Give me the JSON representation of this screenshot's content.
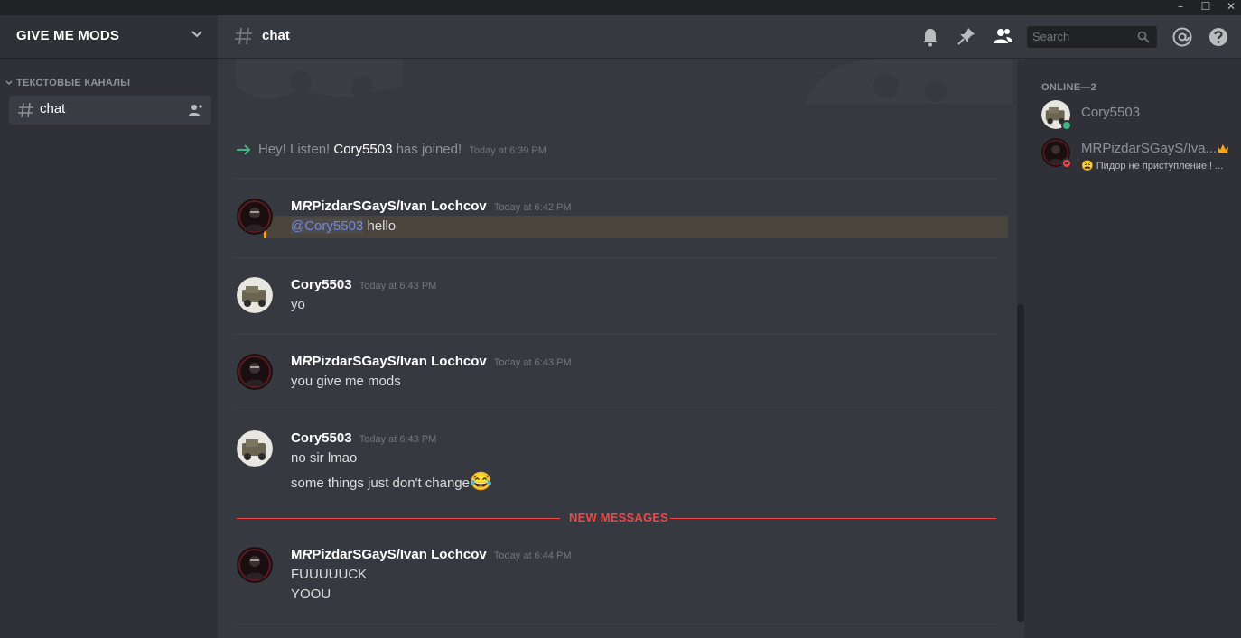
{
  "window": {
    "minimize_glyph": "–",
    "maximize_glyph": "☐",
    "close_glyph": "✕"
  },
  "server": {
    "name": "GIVE ME MODS",
    "category": "ТЕКСТОВЫЕ КАНАЛЫ",
    "channels": [
      {
        "label": "chat",
        "active": true
      }
    ]
  },
  "header": {
    "channel": "chat",
    "search_placeholder": "Search",
    "icons": [
      "bell-icon",
      "pin-icon",
      "members-icon",
      "mention-icon",
      "help-icon"
    ]
  },
  "messages": {
    "system": {
      "prefix": "Hey! Listen! ",
      "user": "Cory5503",
      "suffix": " has joined!",
      "time": "Today at 6:39 PM"
    },
    "groups": [
      {
        "author_pre": "M",
        "author_mid": "R",
        "author_post": "PizdarSGayS/Ivan Lochcov",
        "time": "Today at 6:42 PM",
        "mention": "@Cory5503",
        "lines": [
          "hello"
        ]
      },
      {
        "author": "Cory5503",
        "time": "Today at 6:43 PM",
        "lines": [
          "yo"
        ]
      },
      {
        "author_pre": "M",
        "author_mid": "R",
        "author_post": "PizdarSGayS/Ivan Lochcov",
        "time": "Today at 6:43 PM",
        "lines": [
          "you give me mods"
        ]
      },
      {
        "author": "Cory5503",
        "time": "Today at 6:43 PM",
        "lines": [
          "no sir lmao",
          "some things just don't change"
        ],
        "emoji": "😂"
      },
      {
        "author_pre": "M",
        "author_mid": "R",
        "author_post": "PizdarSGayS/Ivan Lochcov",
        "time": "Today at 6:44 PM",
        "lines": [
          "FUUUUUCK",
          "YOOU"
        ]
      }
    ],
    "new_messages_label": "NEW MESSAGES"
  },
  "members": {
    "online_label": "ONLINE—2",
    "list": [
      {
        "name": "Cory5503",
        "status": "online",
        "status_color": "#43b581"
      },
      {
        "name": "MRPizdarSGayS/Iva...",
        "status": "dnd",
        "status_color": "#f04747",
        "owner": true,
        "activity_emoji": "😩",
        "activity": "Пидор не приступление ! ..."
      }
    ]
  },
  "colors": {
    "accent": "#7289da",
    "mention_bar": "#faa61a",
    "new_messages": "#f04747",
    "join_arrow": "#43b581"
  }
}
